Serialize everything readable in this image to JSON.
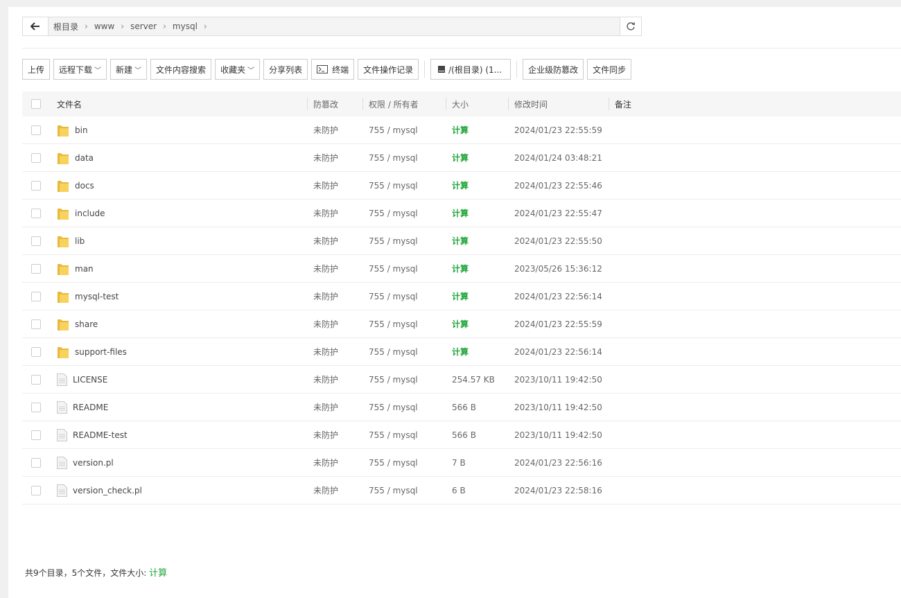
{
  "breadcrumb": {
    "items": [
      "根目录",
      "www",
      "server",
      "mysql"
    ]
  },
  "toolbar": {
    "upload": "上传",
    "remote_download": "远程下载",
    "new": "新建",
    "content_search": "文件内容搜索",
    "favorites": "收藏夹",
    "share_list": "分享列表",
    "terminal": "终端",
    "operation_log": "文件操作记录",
    "disk": "/(根目录) (1...",
    "tamper_proof": "企业级防篡改",
    "file_sync": "文件同步"
  },
  "table": {
    "headers": {
      "name": "文件名",
      "protect": "防篡改",
      "perm": "权限 / 所有者",
      "size": "大小",
      "mtime": "修改时间",
      "note": "备注"
    },
    "rows": [
      {
        "type": "folder",
        "name": "bin",
        "protect": "未防护",
        "perm": "755 / mysql",
        "size": "计算",
        "mtime": "2024/01/23 22:55:59"
      },
      {
        "type": "folder",
        "name": "data",
        "protect": "未防护",
        "perm": "755 / mysql",
        "size": "计算",
        "mtime": "2024/01/24 03:48:21"
      },
      {
        "type": "folder",
        "name": "docs",
        "protect": "未防护",
        "perm": "755 / mysql",
        "size": "计算",
        "mtime": "2024/01/23 22:55:46"
      },
      {
        "type": "folder",
        "name": "include",
        "protect": "未防护",
        "perm": "755 / mysql",
        "size": "计算",
        "mtime": "2024/01/23 22:55:47"
      },
      {
        "type": "folder",
        "name": "lib",
        "protect": "未防护",
        "perm": "755 / mysql",
        "size": "计算",
        "mtime": "2024/01/23 22:55:50"
      },
      {
        "type": "folder",
        "name": "man",
        "protect": "未防护",
        "perm": "755 / mysql",
        "size": "计算",
        "mtime": "2023/05/26 15:36:12"
      },
      {
        "type": "folder",
        "name": "mysql-test",
        "protect": "未防护",
        "perm": "755 / mysql",
        "size": "计算",
        "mtime": "2024/01/23 22:56:14"
      },
      {
        "type": "folder",
        "name": "share",
        "protect": "未防护",
        "perm": "755 / mysql",
        "size": "计算",
        "mtime": "2024/01/23 22:55:59"
      },
      {
        "type": "folder",
        "name": "support-files",
        "protect": "未防护",
        "perm": "755 / mysql",
        "size": "计算",
        "mtime": "2024/01/23 22:56:14"
      },
      {
        "type": "file",
        "name": "LICENSE",
        "protect": "未防护",
        "perm": "755 / mysql",
        "size": "254.57 KB",
        "mtime": "2023/10/11 19:42:50"
      },
      {
        "type": "file",
        "name": "README",
        "protect": "未防护",
        "perm": "755 / mysql",
        "size": "566 B",
        "mtime": "2023/10/11 19:42:50"
      },
      {
        "type": "file",
        "name": "README-test",
        "protect": "未防护",
        "perm": "755 / mysql",
        "size": "566 B",
        "mtime": "2023/10/11 19:42:50"
      },
      {
        "type": "file",
        "name": "version.pl",
        "protect": "未防护",
        "perm": "755 / mysql",
        "size": "7 B",
        "mtime": "2024/01/23 22:56:16"
      },
      {
        "type": "file",
        "name": "version_check.pl",
        "protect": "未防护",
        "perm": "755 / mysql",
        "size": "6 B",
        "mtime": "2024/01/23 22:58:16"
      }
    ]
  },
  "footer": {
    "summary": "共9个目录，5个文件，文件大小:",
    "calc": "计算"
  },
  "colors": {
    "accent_green": "#20a53a",
    "folder_yellow": "#f5c542"
  }
}
